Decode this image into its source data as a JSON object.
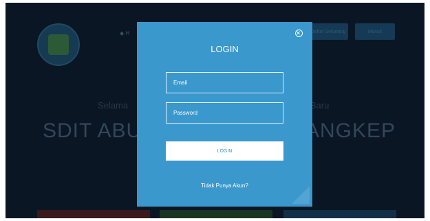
{
  "background": {
    "nav_link": "◆ H",
    "buttons": [
      "Daftar Sekarang",
      "Masuk"
    ],
    "welcome_left": "Selama",
    "welcome_right": "a Baru",
    "hero_left": "SDIT ABU",
    "hero_right": "ANGKEP"
  },
  "modal": {
    "title": "LOGIN",
    "email_placeholder": "Email",
    "password_placeholder": "Password",
    "login_label": "LOGIN",
    "register_link": "Tidak Punya Akun?"
  },
  "colors": {
    "modal_bg": "#3a98cc",
    "overlay_bg": "#0b1624",
    "button_text": "#3a98cc"
  },
  "icons": {
    "close": "close-circle-icon"
  }
}
